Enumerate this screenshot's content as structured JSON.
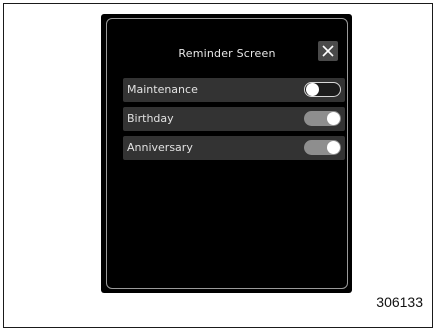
{
  "screen": {
    "title": "Reminder Screen",
    "close_icon": "close-icon",
    "items": [
      {
        "label": "Maintenance",
        "toggle_on": false
      },
      {
        "label": "Birthday",
        "toggle_on": true
      },
      {
        "label": "Anniversary",
        "toggle_on": true
      }
    ]
  },
  "figure_number": "306133",
  "colors": {
    "screen_background": "#000000",
    "row_background": "#333333",
    "toggle_on": "#8e8e8e",
    "toggle_off_border": "#d8d8d8"
  }
}
